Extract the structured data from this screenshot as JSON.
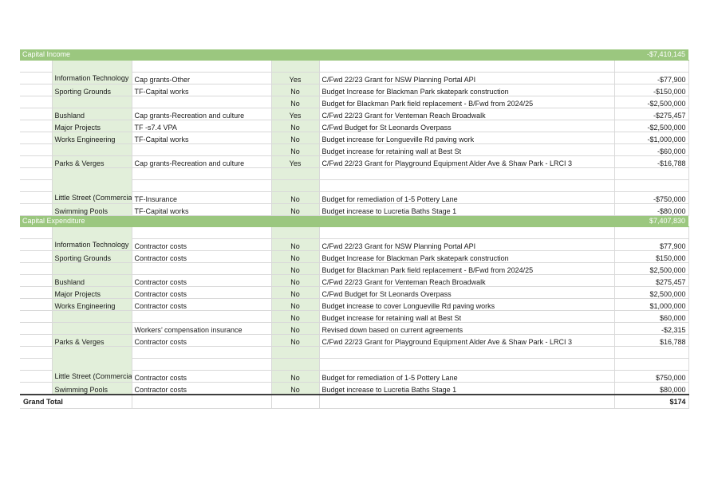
{
  "colors": {
    "section_header_bg": "#9bc77f",
    "section_header_text": "#ffffff",
    "light_green_cell": "#e2efda",
    "grid_line": "#d9d9d9",
    "total_rule": "#3f3f3f"
  },
  "sections": [
    {
      "id": "capital-income",
      "title": "Capital Income",
      "total": "-$7,410,145",
      "rows": [
        {
          "blank": "",
          "dept": "Information Technology",
          "dept_rowspan": 2,
          "dept_wrap": true,
          "account": "",
          "gst": "",
          "description": "",
          "amount": ""
        },
        {
          "blank": "",
          "dept_skip": true,
          "account": "Cap grants-Other",
          "gst": "Yes",
          "description": "C/Fwd 22/23 Grant for NSW Planning Portal API",
          "amount": "-$77,900"
        },
        {
          "blank": "",
          "dept": "Sporting Grounds",
          "account": "TF-Capital works",
          "gst": "No",
          "description": "Budget Increase for Blackman Park skatepark construction",
          "amount": "-$150,000"
        },
        {
          "blank": "",
          "dept": "",
          "account": "",
          "gst": "No",
          "description": "Budget for Blackman Park field replacement - B/Fwd from 2024/25",
          "amount": "-$2,500,000"
        },
        {
          "blank": "",
          "dept": "Bushland",
          "account": "Cap grants-Recreation and culture",
          "gst": "Yes",
          "description": "C/Fwd 22/23 Grant for Venteman Reach Broadwalk",
          "amount": "-$275,457"
        },
        {
          "blank": "",
          "dept": "Major Projects",
          "account": "TF -s7.4 VPA",
          "gst": "No",
          "description": "C/Fwd Budget for St Leonards Overpass",
          "amount": "-$2,500,000"
        },
        {
          "blank": "",
          "dept": "Works Engineering",
          "account": "TF-Capital works",
          "gst": "No",
          "description": "Budget increase for Longueville Rd paving work",
          "amount": "-$1,000,000"
        },
        {
          "blank": "",
          "dept": "",
          "account": "",
          "gst": "No",
          "description": "Budget increase for retaining wall at Best St",
          "amount": "-$60,000"
        },
        {
          "blank": "",
          "dept": "Parks & Verges",
          "account": "Cap grants-Recreation and culture",
          "gst": "Yes",
          "description": "C/Fwd 22/23 Grant for Playground Equipment Alder Ave & Shaw Park - LRCI 3",
          "amount": "-$16,788"
        },
        {
          "blank": "",
          "dept": "Little Street (Commercial branch only)",
          "dept_rowspan": 3,
          "dept_wrap": true,
          "account": "",
          "gst": "",
          "description": "",
          "amount": ""
        },
        {
          "blank": "",
          "dept_skip": true,
          "account": "",
          "gst": "",
          "description": "",
          "amount": ""
        },
        {
          "blank": "",
          "dept_skip": true,
          "account": "TF-Insurance",
          "gst": "No",
          "description": "Budget for remediation of 1-5 Pottery Lane",
          "amount": "-$750,000"
        },
        {
          "blank": "",
          "dept": "Swimming Pools",
          "account": "TF-Capital works",
          "gst": "No",
          "description": "Budget increase to Lucretia Baths Stage 1",
          "amount": "-$80,000"
        }
      ]
    },
    {
      "id": "capital-expenditure",
      "title": "Capital Expenditure",
      "total": "$7,407,830",
      "rows": [
        {
          "blank": "",
          "dept": "Information Technology",
          "dept_rowspan": 2,
          "dept_wrap": true,
          "account": "",
          "gst": "",
          "description": "",
          "amount": ""
        },
        {
          "blank": "",
          "dept_skip": true,
          "account": "Contractor costs",
          "gst": "No",
          "description": "C/Fwd 22/23 Grant for NSW Planning Portal API",
          "amount": "$77,900"
        },
        {
          "blank": "",
          "dept": "Sporting Grounds",
          "account": "Contractor costs",
          "gst": "No",
          "description": "Budget Increase for Blackman Park skatepark construction",
          "amount": "$150,000"
        },
        {
          "blank": "",
          "dept": "",
          "account": "",
          "gst": "No",
          "description": "Budget for Blackman Park field replacement - B/Fwd from 2024/25",
          "amount": "$2,500,000"
        },
        {
          "blank": "",
          "dept": "Bushland",
          "account": "Contractor costs",
          "gst": "No",
          "description": "C/Fwd 22/23 Grant for Venteman Reach Broadwalk",
          "amount": "$275,457"
        },
        {
          "blank": "",
          "dept": "Major Projects",
          "account": "Contractor costs",
          "gst": "No",
          "description": "C/Fwd Budget for St Leonards Overpass",
          "amount": "$2,500,000"
        },
        {
          "blank": "",
          "dept": "Works Engineering",
          "account": "Contractor costs",
          "gst": "No",
          "description": "Budget increase to cover Longueville Rd paving works",
          "amount": "$1,000,000"
        },
        {
          "blank": "",
          "dept": "",
          "account": "",
          "gst": "No",
          "description": "Budget increase for retaining wall at Best St",
          "amount": "$60,000"
        },
        {
          "blank": "",
          "dept": "",
          "account": "Workers’ compensation insurance",
          "gst": "No",
          "description": "Revised down based on current agreements",
          "amount": "-$2,315"
        },
        {
          "blank": "",
          "dept": "Parks & Verges",
          "account": "Contractor costs",
          "gst": "No",
          "description": "C/Fwd 22/23 Grant for Playground Equipment Alder Ave & Shaw Park - LRCI 3",
          "amount": "$16,788"
        },
        {
          "blank": "",
          "dept": "Little Street (Commercial branch only)",
          "dept_rowspan": 3,
          "dept_wrap": true,
          "account": "",
          "gst": "",
          "description": "",
          "amount": ""
        },
        {
          "blank": "",
          "dept_skip": true,
          "account": "",
          "gst": "",
          "description": "",
          "amount": ""
        },
        {
          "blank": "",
          "dept_skip": true,
          "account": "Contractor costs",
          "gst": "No",
          "description": "Budget for remediation of 1-5 Pottery Lane",
          "amount": "$750,000"
        },
        {
          "blank": "",
          "dept": "Swimming Pools",
          "account": "Contractor costs",
          "gst": "No",
          "description": "Budget increase to Lucretia Baths Stage 1",
          "amount": "$80,000"
        }
      ]
    }
  ],
  "grand_total": {
    "label": "Grand Total",
    "amount": "$174"
  }
}
